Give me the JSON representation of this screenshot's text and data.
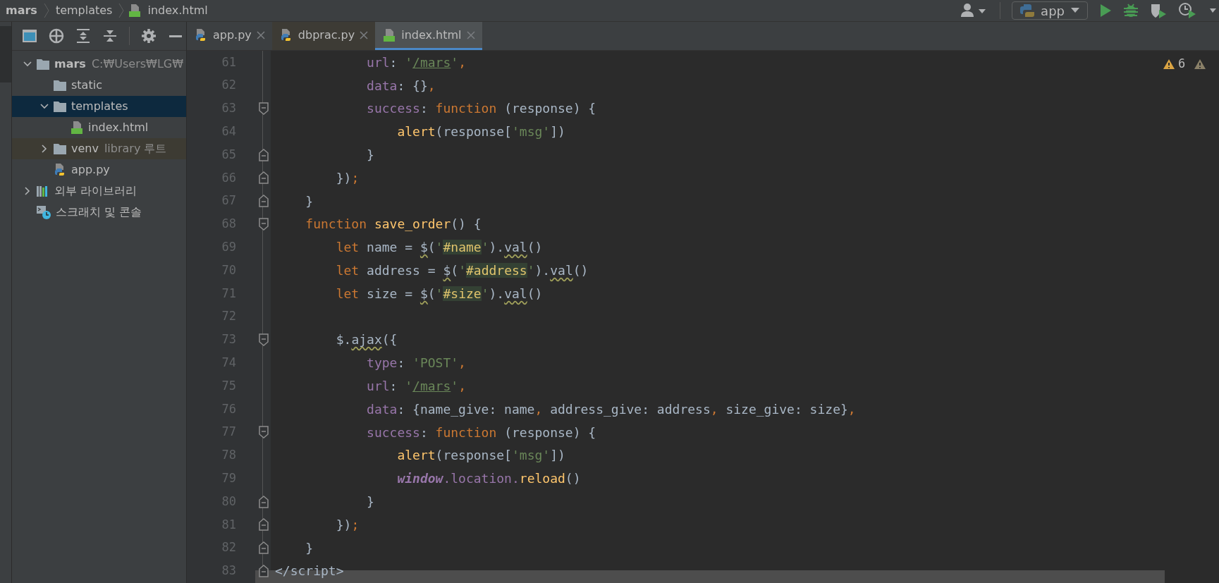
{
  "breadcrumb": [
    {
      "label": "mars",
      "kind": "project"
    },
    {
      "label": "templates",
      "kind": "folder"
    },
    {
      "label": "index.html",
      "kind": "html"
    }
  ],
  "run_config": {
    "label": "app"
  },
  "tabs": [
    {
      "label": "app.py",
      "kind": "python",
      "selected": false,
      "color": "#3c3f41"
    },
    {
      "label": "dbprac.py",
      "kind": "python",
      "selected": false,
      "color": "#3d3b35"
    },
    {
      "label": "index.html",
      "kind": "html",
      "selected": true,
      "color": "#4e5254"
    }
  ],
  "project_tree": [
    {
      "label": "mars",
      "hint": "C:₩Users₩LG₩",
      "kind": "folder",
      "expanded": true,
      "selected": false,
      "tinted": false,
      "children": [
        {
          "label": "static",
          "kind": "folder",
          "selected": false,
          "tinted": false
        },
        {
          "label": "templates",
          "kind": "folder",
          "expanded": true,
          "selected": true,
          "tinted": false,
          "children": [
            {
              "label": "index.html",
              "kind": "html",
              "selected": false,
              "tinted": false
            }
          ]
        },
        {
          "label": "venv",
          "hint": "library 루트",
          "kind": "folder",
          "expanded": false,
          "selected": false,
          "tinted": true
        },
        {
          "label": "app.py",
          "kind": "python",
          "selected": false,
          "tinted": false
        }
      ]
    },
    {
      "label": "외부 라이브러리",
      "kind": "libraries",
      "expanded": false,
      "selected": false,
      "tinted": false
    },
    {
      "label": "스크래치 및 콘솔",
      "kind": "scratches",
      "selected": false,
      "tinted": false
    }
  ],
  "warnings": {
    "count": "6"
  },
  "lines": [
    {
      "number": "61",
      "tokens": [
        {
          "kind": "prop",
          "text": "            url"
        },
        {
          "kind": "plain",
          "text": ": "
        },
        {
          "kind": "string",
          "text": "'"
        },
        {
          "kind": "link",
          "text": "/mars"
        },
        {
          "kind": "string",
          "text": "'"
        },
        {
          "kind": "punct",
          "text": ","
        }
      ]
    },
    {
      "number": "62",
      "tokens": [
        {
          "kind": "prop",
          "text": "            data"
        },
        {
          "kind": "plain",
          "text": ": {}"
        },
        {
          "kind": "punct",
          "text": ","
        }
      ]
    },
    {
      "number": "63",
      "fold": {
        "kind": "start"
      },
      "tokens": [
        {
          "kind": "prop",
          "text": "            success"
        },
        {
          "kind": "plain",
          "text": ": "
        },
        {
          "kind": "keyword",
          "text": "function"
        },
        {
          "kind": "plain",
          "text": " (response) {"
        }
      ]
    },
    {
      "number": "64",
      "tokens": [
        {
          "kind": "func",
          "text": "                alert"
        },
        {
          "kind": "plain",
          "text": "(response["
        },
        {
          "kind": "string",
          "text": "'msg'"
        },
        {
          "kind": "plain",
          "text": "])"
        }
      ]
    },
    {
      "number": "65",
      "fold": {
        "kind": "end"
      },
      "tokens": [
        {
          "kind": "plain",
          "text": "            }"
        }
      ]
    },
    {
      "number": "66",
      "fold": {
        "kind": "end"
      },
      "tokens": [
        {
          "kind": "plain",
          "text": "        })"
        },
        {
          "kind": "punct",
          "text": ";"
        }
      ]
    },
    {
      "number": "67",
      "fold": {
        "kind": "end"
      },
      "tokens": [
        {
          "kind": "plain",
          "text": "    }"
        }
      ]
    },
    {
      "number": "68",
      "fold": {
        "kind": "start"
      },
      "tokens": [
        {
          "kind": "keyword",
          "text": "    function"
        },
        {
          "kind": "func",
          "text": " save_order"
        },
        {
          "kind": "plain",
          "text": "() {"
        }
      ]
    },
    {
      "number": "69",
      "tokens": [
        {
          "kind": "keyword",
          "text": "        let"
        },
        {
          "kind": "plain",
          "text": " name = "
        },
        {
          "kind": "flagged",
          "text": "$"
        },
        {
          "kind": "plain",
          "text": "("
        },
        {
          "kind": "string",
          "text": "'"
        },
        {
          "kind": "match",
          "text": "#name"
        },
        {
          "kind": "string",
          "text": "'"
        },
        {
          "kind": "plain",
          "text": ")."
        },
        {
          "kind": "flagged",
          "text": "val"
        },
        {
          "kind": "plain",
          "text": "()"
        }
      ]
    },
    {
      "number": "70",
      "tokens": [
        {
          "kind": "keyword",
          "text": "        let"
        },
        {
          "kind": "plain",
          "text": " address = "
        },
        {
          "kind": "flagged",
          "text": "$"
        },
        {
          "kind": "plain",
          "text": "("
        },
        {
          "kind": "string",
          "text": "'"
        },
        {
          "kind": "match",
          "text": "#address"
        },
        {
          "kind": "string",
          "text": "'"
        },
        {
          "kind": "plain",
          "text": ")."
        },
        {
          "kind": "flagged",
          "text": "val"
        },
        {
          "kind": "plain",
          "text": "()"
        }
      ]
    },
    {
      "number": "71",
      "tokens": [
        {
          "kind": "keyword",
          "text": "        let"
        },
        {
          "kind": "plain",
          "text": " size = "
        },
        {
          "kind": "flagged",
          "text": "$"
        },
        {
          "kind": "plain",
          "text": "("
        },
        {
          "kind": "string",
          "text": "'"
        },
        {
          "kind": "match",
          "text": "#size"
        },
        {
          "kind": "string",
          "text": "'"
        },
        {
          "kind": "plain",
          "text": ")."
        },
        {
          "kind": "flagged",
          "text": "val"
        },
        {
          "kind": "plain",
          "text": "()"
        }
      ]
    },
    {
      "number": "72"
    },
    {
      "number": "73",
      "fold": {
        "kind": "start"
      },
      "tokens": [
        {
          "kind": "plain",
          "text": "        $."
        },
        {
          "kind": "flagged",
          "text": "ajax"
        },
        {
          "kind": "plain",
          "text": "({"
        }
      ]
    },
    {
      "number": "74",
      "tokens": [
        {
          "kind": "prop",
          "text": "            type"
        },
        {
          "kind": "plain",
          "text": ": "
        },
        {
          "kind": "string",
          "text": "'POST'"
        },
        {
          "kind": "punct",
          "text": ","
        }
      ]
    },
    {
      "number": "75",
      "tokens": [
        {
          "kind": "prop",
          "text": "            url"
        },
        {
          "kind": "plain",
          "text": ": "
        },
        {
          "kind": "string",
          "text": "'"
        },
        {
          "kind": "link",
          "text": "/mars"
        },
        {
          "kind": "string",
          "text": "'"
        },
        {
          "kind": "punct",
          "text": ","
        }
      ]
    },
    {
      "number": "76",
      "tokens": [
        {
          "kind": "prop",
          "text": "            data"
        },
        {
          "kind": "plain",
          "text": ": {name_give: name"
        },
        {
          "kind": "punct",
          "text": ","
        },
        {
          "kind": "plain",
          "text": " address_give: address"
        },
        {
          "kind": "punct",
          "text": ","
        },
        {
          "kind": "plain",
          "text": " size_give: size}"
        },
        {
          "kind": "punct",
          "text": ","
        }
      ]
    },
    {
      "number": "77",
      "fold": {
        "kind": "start"
      },
      "tokens": [
        {
          "kind": "prop",
          "text": "            success"
        },
        {
          "kind": "plain",
          "text": ": "
        },
        {
          "kind": "keyword",
          "text": "function"
        },
        {
          "kind": "plain",
          "text": " (response) {"
        }
      ]
    },
    {
      "number": "78",
      "tokens": [
        {
          "kind": "func",
          "text": "                alert"
        },
        {
          "kind": "plain",
          "text": "(response["
        },
        {
          "kind": "string",
          "text": "'msg'"
        },
        {
          "kind": "plain",
          "text": "])"
        }
      ]
    },
    {
      "number": "79",
      "tokens": [
        {
          "kind": "global",
          "text": "                window"
        },
        {
          "kind": "member",
          "text": ".location."
        },
        {
          "kind": "func",
          "text": "reload"
        },
        {
          "kind": "plain",
          "text": "()"
        }
      ]
    },
    {
      "number": "80",
      "fold": {
        "kind": "end"
      },
      "tokens": [
        {
          "kind": "plain",
          "text": "            }"
        }
      ]
    },
    {
      "number": "81",
      "fold": {
        "kind": "end"
      },
      "tokens": [
        {
          "kind": "plain",
          "text": "        })"
        },
        {
          "kind": "punct",
          "text": ";"
        }
      ]
    },
    {
      "number": "82",
      "fold": {
        "kind": "end"
      },
      "tokens": [
        {
          "kind": "plain",
          "text": "    }"
        }
      ]
    },
    {
      "number": "83",
      "fold": {
        "kind": "end"
      },
      "tokens": [
        {
          "kind": "plain",
          "text": "</script>"
        }
      ]
    }
  ]
}
